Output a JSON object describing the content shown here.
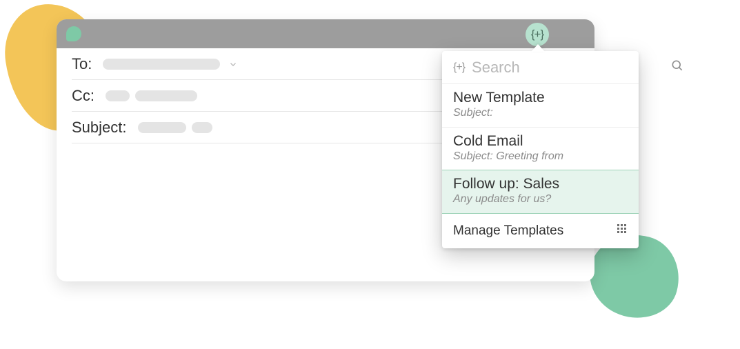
{
  "compose": {
    "to_label": "To:",
    "cc_label": "Cc:",
    "subject_label": "Subject:"
  },
  "template_button": {
    "glyph": "{+}"
  },
  "popover": {
    "search": {
      "prefix": "{+}",
      "placeholder": "Search"
    },
    "items": [
      {
        "title": "New Template",
        "sub": "Subject:",
        "selected": false
      },
      {
        "title": "Cold Email",
        "sub": "Subject: Greeting from",
        "selected": false
      },
      {
        "title": "Follow up: Sales",
        "sub": "Any updates for us?",
        "selected": true
      }
    ],
    "manage_label": "Manage Templates"
  }
}
